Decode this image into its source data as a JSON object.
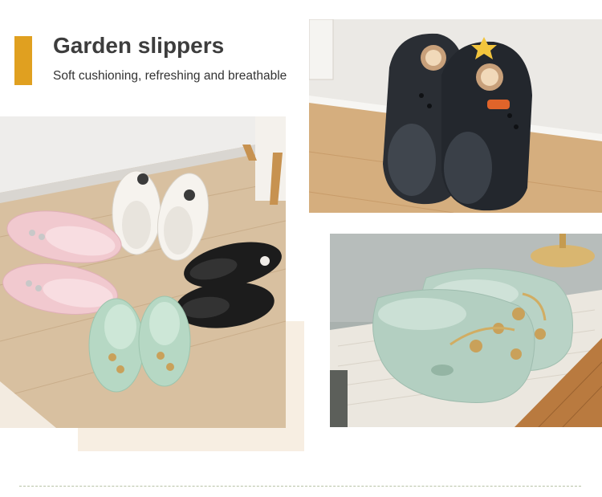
{
  "header": {
    "title": "Garden slippers",
    "subtitle": "Soft cushioning, refreshing and breathable"
  },
  "photos": {
    "group": {
      "icon": "slippers-circle-photo",
      "label": ""
    },
    "black_pair": {
      "icon": "black-slippers-photo",
      "label": ""
    },
    "mint_pair": {
      "icon": "mint-slippers-photo",
      "label": ""
    }
  },
  "colors": {
    "accent": "#e0a020",
    "title_text": "#3d3d3d",
    "beige_block": "#f7eee2",
    "divider": "#b8c3a6"
  }
}
